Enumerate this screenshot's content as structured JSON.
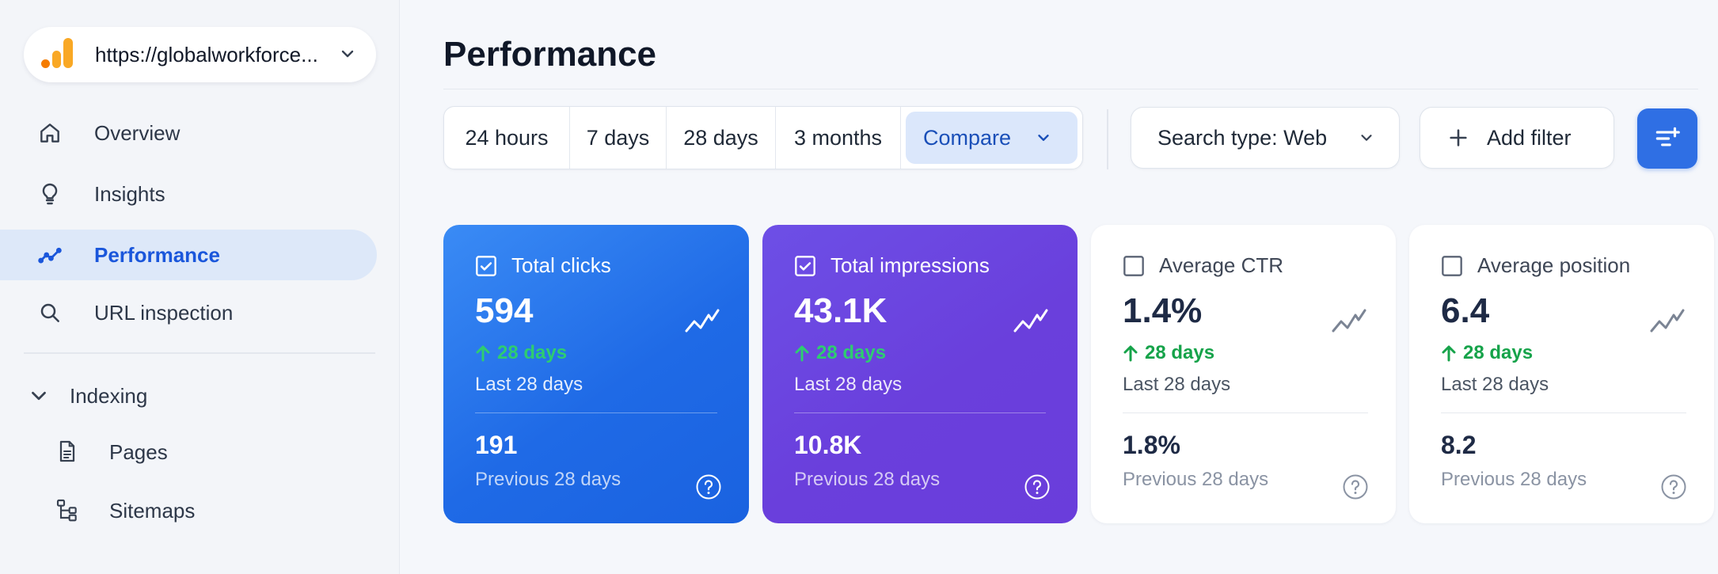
{
  "property": {
    "url": "https://globalworkforce..."
  },
  "sidebar": {
    "items": [
      {
        "label": "Overview",
        "icon": "home-icon"
      },
      {
        "label": "Insights",
        "icon": "lightbulb-icon"
      },
      {
        "label": "Performance",
        "icon": "performance-icon",
        "active": true
      },
      {
        "label": "URL inspection",
        "icon": "search-icon"
      }
    ],
    "section": {
      "label": "Indexing",
      "expanded": true
    },
    "sub_items": [
      {
        "label": "Pages",
        "icon": "document-icon"
      },
      {
        "label": "Sitemaps",
        "icon": "sitemap-icon"
      }
    ]
  },
  "main": {
    "title": "Performance",
    "ranges": [
      "24 hours",
      "7 days",
      "28 days",
      "3 months"
    ],
    "compare_label": "Compare",
    "search_type_label": "Search type: Web",
    "add_filter_label": "Add filter"
  },
  "cards": [
    {
      "name": "Total clicks",
      "value": "594",
      "delta": "28 days",
      "period": "Last 28 days",
      "prev_value": "191",
      "prev_label": "Previous 28 days",
      "checked": true
    },
    {
      "name": "Total impressions",
      "value": "43.1K",
      "delta": "28 days",
      "period": "Last 28 days",
      "prev_value": "10.8K",
      "prev_label": "Previous 28 days",
      "checked": true
    },
    {
      "name": "Average CTR",
      "value": "1.4%",
      "delta": "28 days",
      "period": "Last 28 days",
      "prev_value": "1.8%",
      "prev_label": "Previous 28 days",
      "checked": false
    },
    {
      "name": "Average position",
      "value": "6.4",
      "delta": "28 days",
      "period": "Last 28 days",
      "prev_value": "8.2",
      "prev_label": "Previous 28 days",
      "checked": false
    }
  ],
  "colors": {
    "accent": "#1a56db",
    "clicks_card": "#2a74ec",
    "impressions_card": "#6a44de",
    "positive": "#22c55e",
    "active_nav_bg": "#dde8f9"
  }
}
